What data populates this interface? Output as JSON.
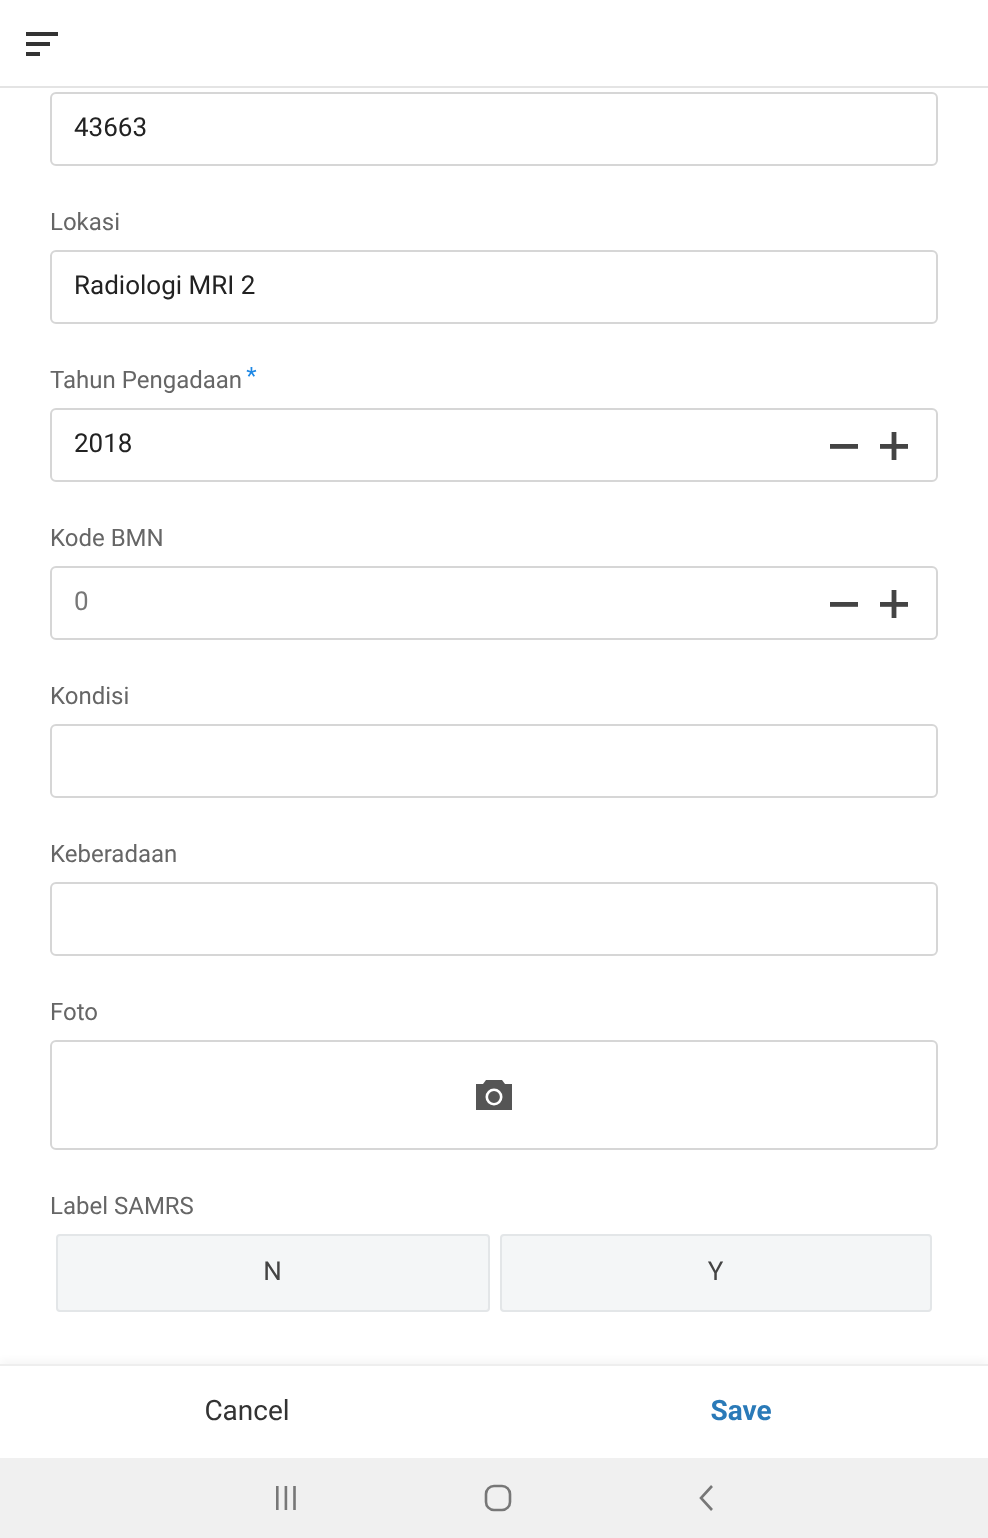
{
  "fields": [
    {
      "kind": "text",
      "value": "43663"
    },
    {
      "kind": "text",
      "label": "Lokasi",
      "value": "Radiologi MRI 2"
    },
    {
      "kind": "stepper",
      "label": "Tahun Pengadaan",
      "required_mark": "*",
      "value": "2018"
    },
    {
      "kind": "stepper",
      "label": "Kode BMN",
      "placeholder": "0"
    },
    {
      "kind": "text",
      "label": "Kondisi"
    },
    {
      "kind": "text",
      "label": "Keberadaan"
    },
    {
      "kind": "photo",
      "label": "Foto"
    },
    {
      "kind": "toggle",
      "label": "Label SAMRS",
      "options": [
        {
          "label": "N",
          "selected": false
        },
        {
          "label": "Y",
          "selected": false
        }
      ]
    }
  ],
  "actions": [
    {
      "label": "Cancel",
      "primary": false
    },
    {
      "label": "Save",
      "primary": true
    }
  ]
}
